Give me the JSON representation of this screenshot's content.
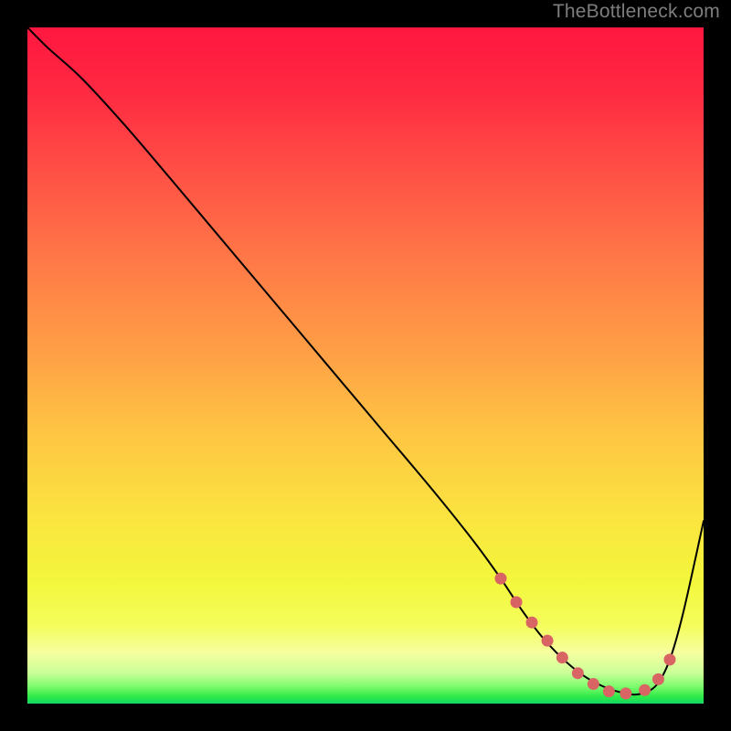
{
  "watermark": "TheBottleneck.com",
  "gradient_stops": [
    {
      "offset": 0,
      "color": "#ff163f"
    },
    {
      "offset": 0.1,
      "color": "#ff2b42"
    },
    {
      "offset": 0.22,
      "color": "#ff5246"
    },
    {
      "offset": 0.35,
      "color": "#ff7a47"
    },
    {
      "offset": 0.48,
      "color": "#ff9f46"
    },
    {
      "offset": 0.6,
      "color": "#fec543"
    },
    {
      "offset": 0.72,
      "color": "#fbe33f"
    },
    {
      "offset": 0.82,
      "color": "#f3f73c"
    },
    {
      "offset": 0.885,
      "color": "#f4fd5c"
    },
    {
      "offset": 0.925,
      "color": "#f6ffa0"
    },
    {
      "offset": 0.955,
      "color": "#c9ff98"
    },
    {
      "offset": 0.975,
      "color": "#7cfb6c"
    },
    {
      "offset": 0.99,
      "color": "#2de948"
    },
    {
      "offset": 1.0,
      "color": "#11d962"
    }
  ],
  "chart_data": {
    "type": "line",
    "title": "",
    "xlabel": "",
    "ylabel": "",
    "xlim": [
      0,
      100
    ],
    "ylim": [
      0,
      100
    ],
    "grid": false,
    "series": [
      {
        "name": "bottleneck-curve",
        "x": [
          0,
          3,
          8,
          14,
          20,
          28,
          36,
          44,
          52,
          60,
          66,
          70,
          73,
          76,
          79,
          82,
          85,
          88,
          90.5,
          93,
          95,
          97,
          100
        ],
        "y": [
          100,
          97,
          92.5,
          86,
          79,
          69.5,
          60,
          50.5,
          41,
          31.5,
          24,
          18.5,
          14,
          10,
          6.8,
          4.3,
          2.6,
          1.6,
          1.4,
          2.7,
          6.5,
          13.5,
          27
        ],
        "stroke": "#000000",
        "stroke_width": 2
      }
    ],
    "markers": {
      "name": "optimal-range-dots",
      "color": "#d96464",
      "radius": 6.5,
      "x": [
        70.0,
        72.3,
        74.6,
        76.9,
        79.1,
        81.4,
        83.7,
        86.0,
        88.5,
        91.3,
        93.3,
        95.0
      ],
      "y": [
        18.5,
        15.0,
        12.0,
        9.3,
        6.8,
        4.5,
        2.9,
        1.8,
        1.5,
        2.0,
        3.6,
        6.5
      ]
    }
  }
}
